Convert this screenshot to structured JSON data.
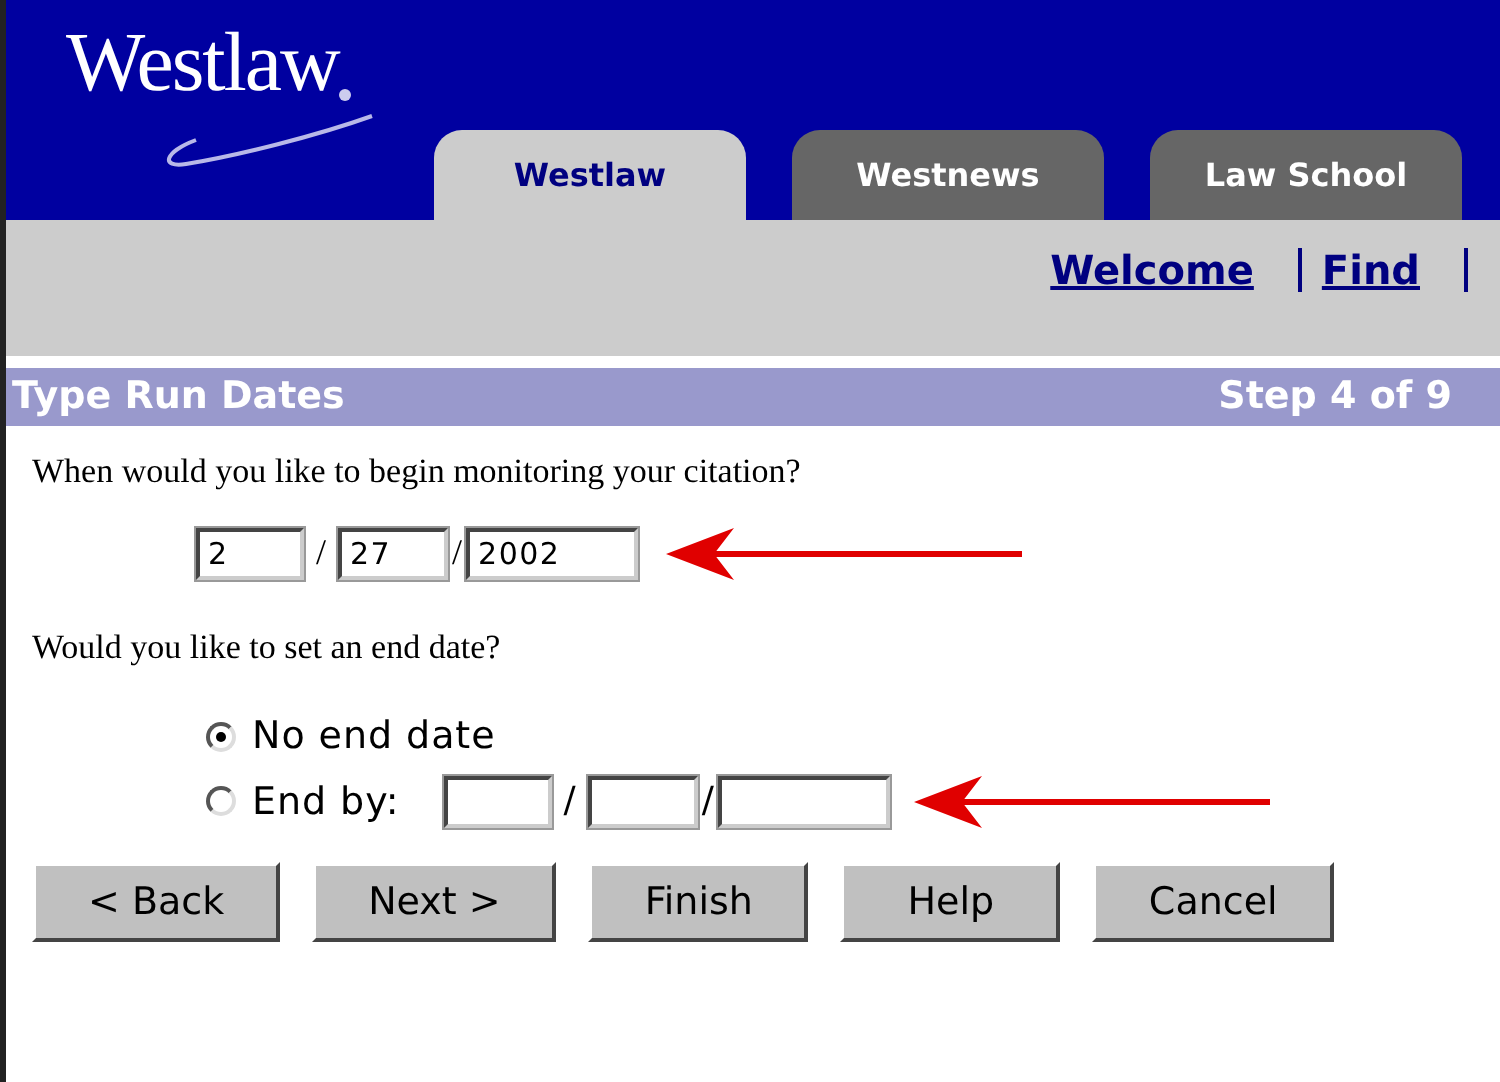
{
  "logo": {
    "text": "Westlaw"
  },
  "tabs": [
    {
      "label": "Westlaw",
      "selected": true
    },
    {
      "label": "Westnews",
      "selected": false
    },
    {
      "label": "Law School",
      "selected": false
    }
  ],
  "nav_links": [
    "Welcome",
    "Find"
  ],
  "step_bar": {
    "title": "Type Run Dates",
    "step": "Step 4 of 9"
  },
  "start_question": "When would you like to begin monitoring your citation?",
  "start_date": {
    "separator": "/",
    "month": "2",
    "day": "27",
    "year": "2002"
  },
  "end_question": "Would you like to set an end date?",
  "end_options": [
    {
      "label": "No end date",
      "selected": true,
      "kind": "plain"
    },
    {
      "label": "End by:",
      "selected": false,
      "kind": "date"
    }
  ],
  "end_date": {
    "separator": "/"
  },
  "buttons": [
    "< Back",
    "Next >",
    "Finish",
    "Help",
    "Cancel"
  ]
}
